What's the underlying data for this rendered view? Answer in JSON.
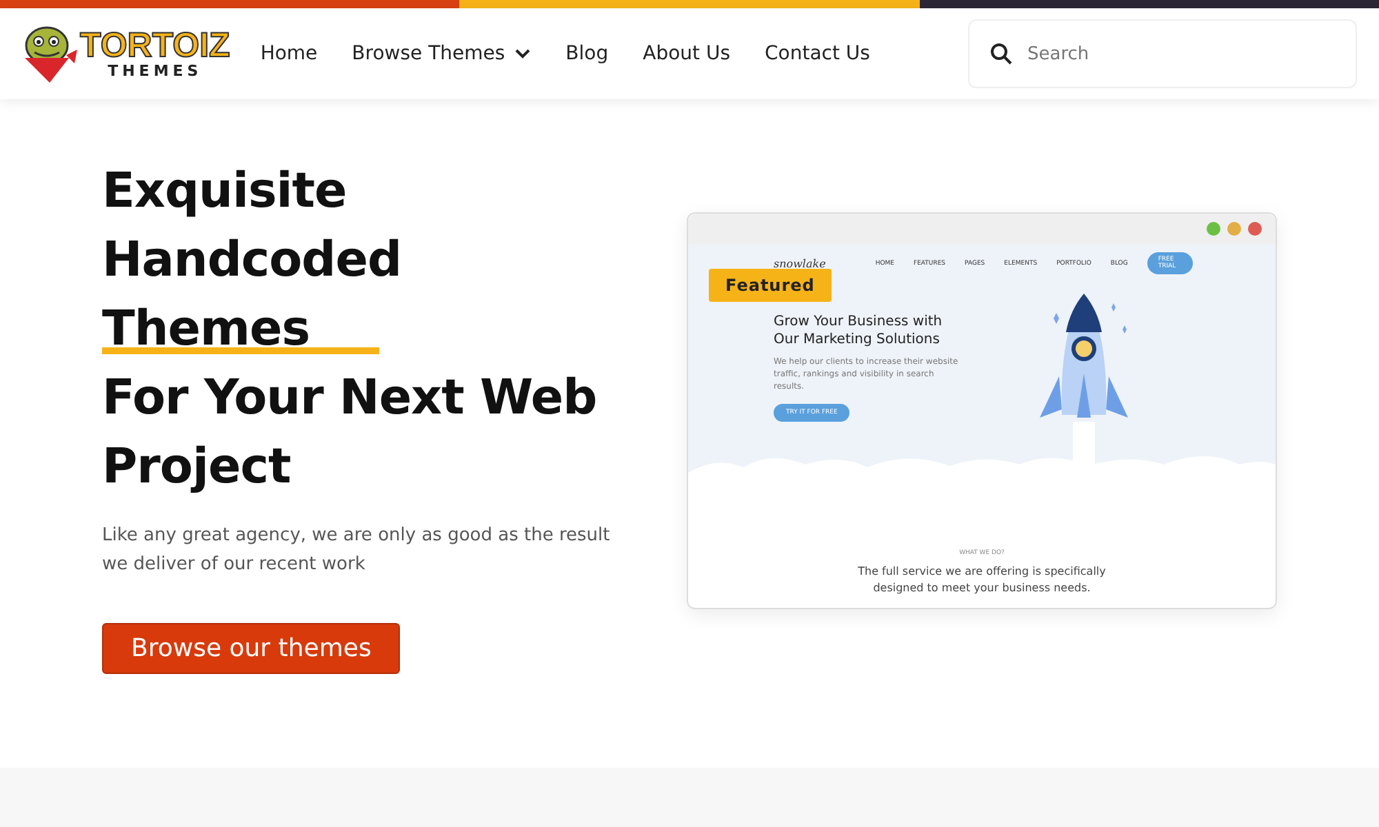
{
  "logo": {
    "wordmark": "TORTOIZ",
    "tagline": "THEMES"
  },
  "nav": [
    {
      "label": "Home",
      "has_dropdown": false
    },
    {
      "label": "Browse Themes",
      "has_dropdown": true
    },
    {
      "label": "Blog",
      "has_dropdown": false
    },
    {
      "label": "About Us",
      "has_dropdown": false
    },
    {
      "label": "Contact Us",
      "has_dropdown": false
    }
  ],
  "search": {
    "placeholder": "Search"
  },
  "hero": {
    "headline": [
      {
        "text": "Exquisite",
        "highlighted": false
      },
      {
        "text": "Handcoded",
        "highlighted": false
      },
      {
        "text": "Themes",
        "highlighted": true
      },
      {
        "text": "For Your Next Web",
        "highlighted": false
      },
      {
        "text": "Project",
        "highlighted": false
      }
    ],
    "subtitle": "Like any great agency, we are only as good as the result we deliver of our recent work",
    "button": "Browse our themes"
  },
  "preview": {
    "badge": "Featured",
    "brand": "snowlake",
    "nav": [
      "HOME",
      "FEATURES",
      "PAGES",
      "ELEMENTS",
      "PORTFOLIO",
      "BLOG"
    ],
    "cta": "FREE TRIAL",
    "title": "Grow Your Business with Our Marketing Solutions",
    "text": "We help our clients to increase their website traffic, rankings and visibility in search results.",
    "button": "TRY IT FOR FREE",
    "eyebrow": "WHAT WE DO?",
    "section_title": "The full service we are offering is specifically designed to meet your business needs.",
    "window_dots": [
      {
        "color": "#6cbf45"
      },
      {
        "color": "#e2ae45"
      },
      {
        "color": "#dd5b52"
      }
    ]
  }
}
